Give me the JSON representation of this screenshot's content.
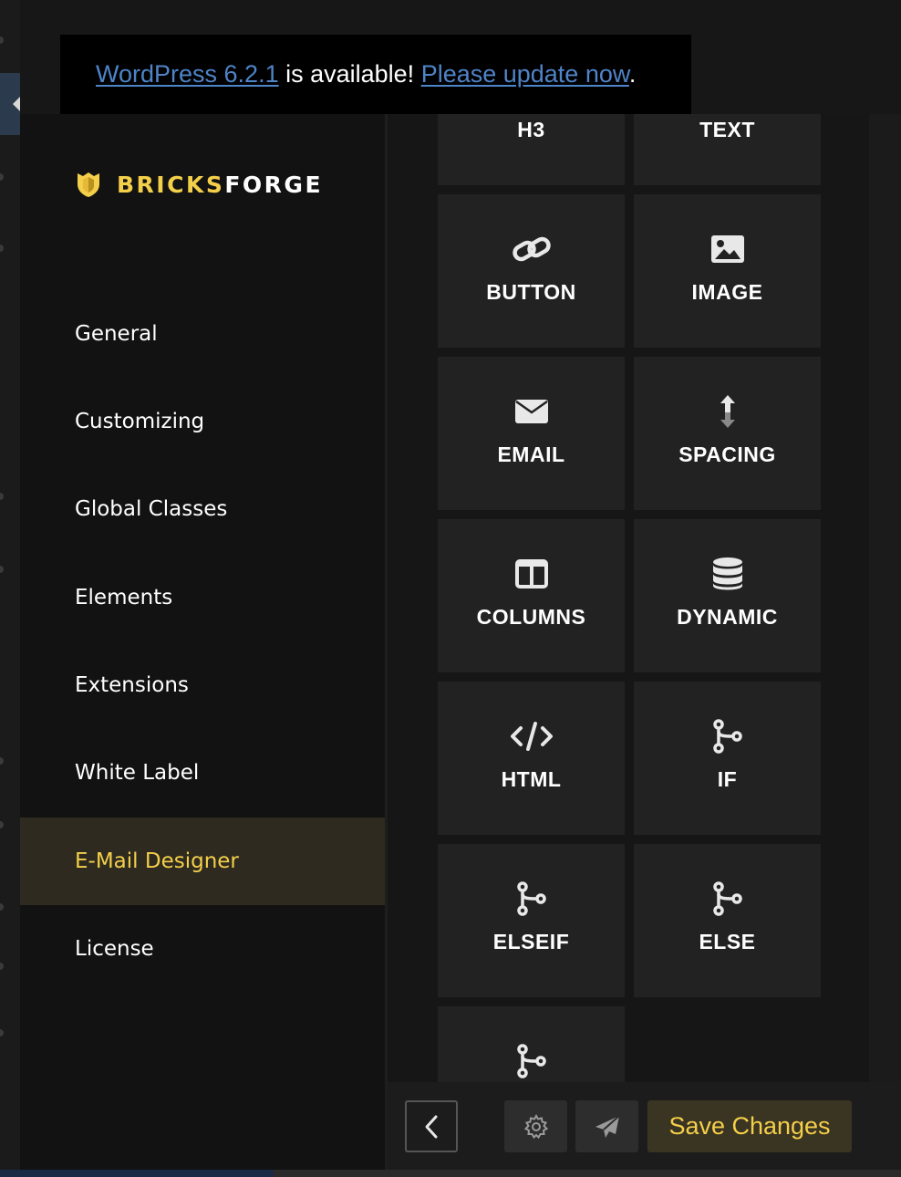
{
  "notice": {
    "version_link": "WordPress 6.2.1",
    "middle_text": " is available! ",
    "update_link": "Please update now",
    "end_text": "."
  },
  "logo": {
    "part1": "BRICKS",
    "part2": "FORGE",
    "icon": "bricksforge-shield-icon"
  },
  "sidebar": {
    "items": [
      {
        "label": "General"
      },
      {
        "label": "Customizing"
      },
      {
        "label": "Global Classes"
      },
      {
        "label": "Elements"
      },
      {
        "label": "Extensions"
      },
      {
        "label": "White Label"
      },
      {
        "label": "E-Mail Designer",
        "active": true
      },
      {
        "label": "License"
      }
    ]
  },
  "elements": [
    {
      "label": "H3"
    },
    {
      "label": "TEXT"
    },
    {
      "label": "BUTTON",
      "icon": "link-icon"
    },
    {
      "label": "IMAGE",
      "icon": "image-icon"
    },
    {
      "label": "EMAIL",
      "icon": "envelope-icon"
    },
    {
      "label": "SPACING",
      "icon": "vertical-arrows-icon"
    },
    {
      "label": "COLUMNS",
      "icon": "columns-icon"
    },
    {
      "label": "DYNAMIC",
      "icon": "database-icon"
    },
    {
      "label": "HTML",
      "icon": "code-icon"
    },
    {
      "label": "IF",
      "icon": "branch-icon"
    },
    {
      "label": "ELSEIF",
      "icon": "branch-icon"
    },
    {
      "label": "ELSE",
      "icon": "branch-icon"
    },
    {
      "label": "",
      "icon": "branch-icon"
    }
  ],
  "footer": {
    "save_label": "Save Changes",
    "back_icon": "chevron-left-icon",
    "settings_icon": "gear-icon",
    "send_icon": "paper-plane-icon"
  },
  "colors": {
    "accent": "#f4cf4a",
    "active_bg": "#2e2a20",
    "tile_bg": "#222222",
    "link": "#4e84c8"
  }
}
